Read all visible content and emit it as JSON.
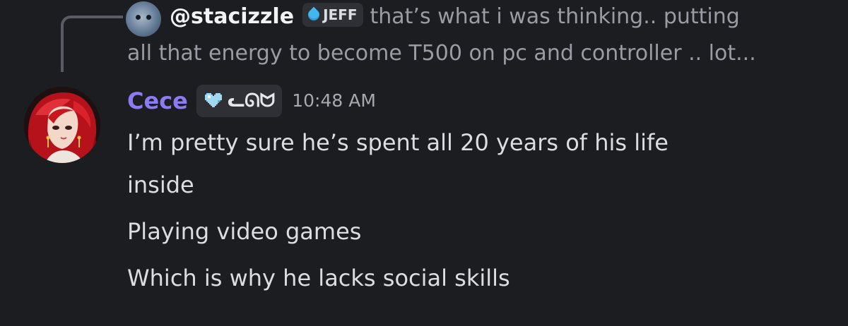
{
  "reply_preview": {
    "author": "@stacizzle",
    "tag_label": "JEFF",
    "tag_icon": "water-drop-icon",
    "text_line1": "that’s what i was thinking.. putting",
    "text_line2": "all that energy to become T500 on pc and controller .. lot..."
  },
  "message": {
    "author": "Cece",
    "author_color": "#8c7cf4",
    "tag_label": "ᓚᘏᗢ",
    "tag_icon": "pixel-heart-icon",
    "timestamp": "10:48 AM",
    "lines": [
      "I’m pretty sure he’s spent all 20 years of his life",
      "inside",
      "Playing video games",
      "Which is why he lacks social skills"
    ]
  }
}
